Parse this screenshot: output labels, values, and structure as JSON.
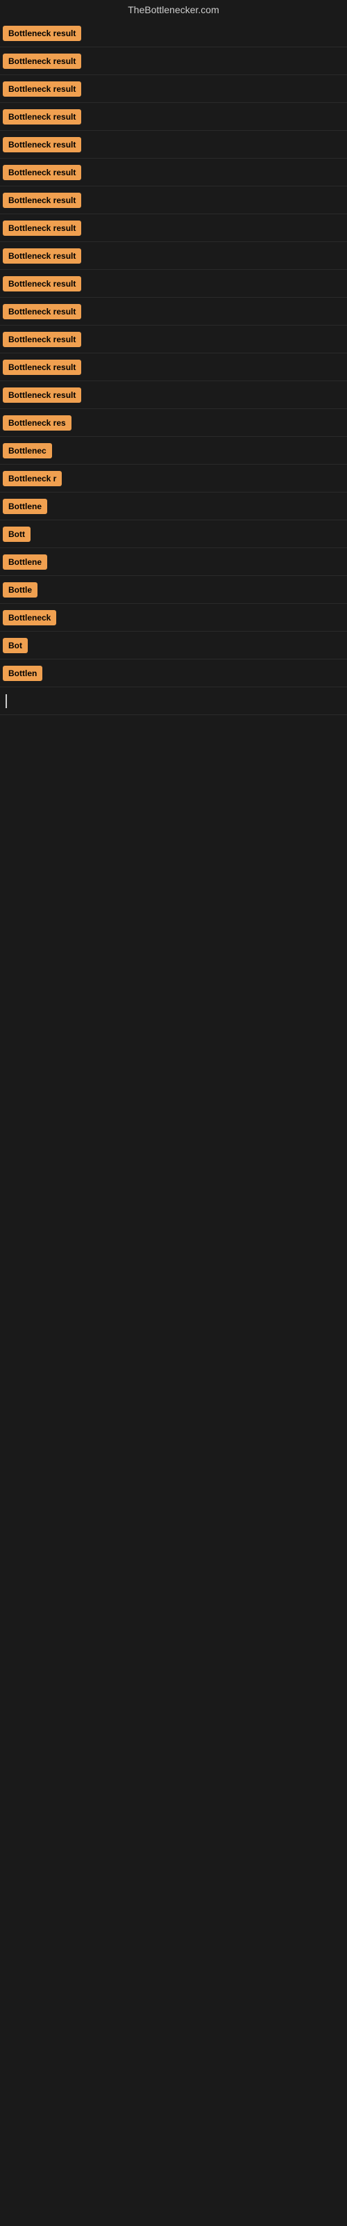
{
  "header": {
    "title": "TheBottlenecker.com"
  },
  "rows": [
    {
      "label": "Bottleneck result",
      "width": 130
    },
    {
      "label": "Bottleneck result",
      "width": 130
    },
    {
      "label": "Bottleneck result",
      "width": 130
    },
    {
      "label": "Bottleneck result",
      "width": 130
    },
    {
      "label": "Bottleneck result",
      "width": 130
    },
    {
      "label": "Bottleneck result",
      "width": 130
    },
    {
      "label": "Bottleneck result",
      "width": 130
    },
    {
      "label": "Bottleneck result",
      "width": 130
    },
    {
      "label": "Bottleneck result",
      "width": 130
    },
    {
      "label": "Bottleneck result",
      "width": 130
    },
    {
      "label": "Bottleneck result",
      "width": 130
    },
    {
      "label": "Bottleneck result",
      "width": 130
    },
    {
      "label": "Bottleneck result",
      "width": 130
    },
    {
      "label": "Bottleneck result",
      "width": 130
    },
    {
      "label": "Bottleneck res",
      "width": 110
    },
    {
      "label": "Bottlenec",
      "width": 80
    },
    {
      "label": "Bottleneck r",
      "width": 90
    },
    {
      "label": "Bottlene",
      "width": 75
    },
    {
      "label": "Bott",
      "width": 45
    },
    {
      "label": "Bottlene",
      "width": 75
    },
    {
      "label": "Bottle",
      "width": 60
    },
    {
      "label": "Bottleneck",
      "width": 85
    },
    {
      "label": "Bot",
      "width": 38
    },
    {
      "label": "Bottlen",
      "width": 65
    }
  ],
  "cursor": {
    "visible": true
  }
}
